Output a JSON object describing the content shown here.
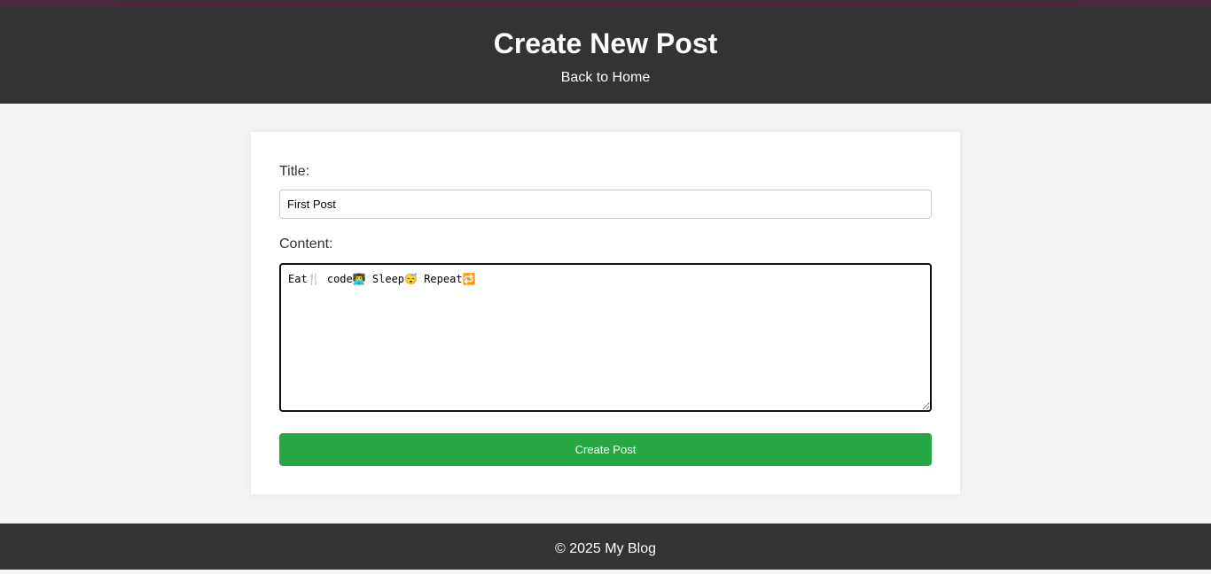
{
  "header": {
    "title": "Create New Post",
    "back_link": "Back to Home"
  },
  "form": {
    "title_label": "Title:",
    "title_value": "First Post",
    "content_label": "Content:",
    "content_value": "Eat🍴 code👨‍💻 Sleep😴 Repeat🔁",
    "submit_label": "Create Post"
  },
  "footer": {
    "text": "© 2025 My Blog"
  },
  "colors": {
    "header_bg": "#333333",
    "page_bg": "#f4f4f4",
    "button_bg": "#28a745"
  }
}
